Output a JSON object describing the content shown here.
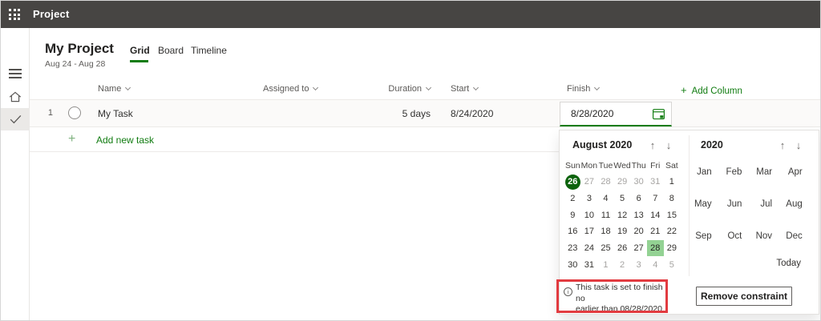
{
  "topbar": {
    "title": "Project"
  },
  "header": {
    "title": "My Project",
    "date_range": "Aug 24 - Aug 28",
    "tabs": [
      {
        "label": "Grid",
        "active": true
      },
      {
        "label": "Board",
        "active": false
      },
      {
        "label": "Timeline",
        "active": false
      }
    ]
  },
  "grid": {
    "columns": [
      {
        "label": "Name"
      },
      {
        "label": "Assigned to"
      },
      {
        "label": "Duration"
      },
      {
        "label": "Start"
      },
      {
        "label": "Finish"
      }
    ],
    "add_column_label": "Add Column",
    "row": {
      "index": "1",
      "name": "My Task",
      "assigned_to": "",
      "duration": "5 days",
      "start": "8/24/2020"
    },
    "add_new_task_label": "Add new task"
  },
  "finish_editor": {
    "value": "8/28/2020"
  },
  "calendar": {
    "title": "August 2020",
    "day_headers": [
      "Sun",
      "Mon",
      "Tue",
      "Wed",
      "Thu",
      "Fri",
      "Sat"
    ],
    "days": [
      {
        "t": "26",
        "s": "today"
      },
      {
        "t": "27",
        "s": "muted"
      },
      {
        "t": "28",
        "s": "muted"
      },
      {
        "t": "29",
        "s": "muted"
      },
      {
        "t": "30",
        "s": "muted"
      },
      {
        "t": "31",
        "s": "muted"
      },
      {
        "t": "1"
      },
      {
        "t": "2"
      },
      {
        "t": "3"
      },
      {
        "t": "4"
      },
      {
        "t": "5"
      },
      {
        "t": "6"
      },
      {
        "t": "7"
      },
      {
        "t": "8"
      },
      {
        "t": "9"
      },
      {
        "t": "10"
      },
      {
        "t": "11"
      },
      {
        "t": "12"
      },
      {
        "t": "13"
      },
      {
        "t": "14"
      },
      {
        "t": "15"
      },
      {
        "t": "16"
      },
      {
        "t": "17"
      },
      {
        "t": "18"
      },
      {
        "t": "19"
      },
      {
        "t": "20"
      },
      {
        "t": "21"
      },
      {
        "t": "22"
      },
      {
        "t": "23"
      },
      {
        "t": "24"
      },
      {
        "t": "25"
      },
      {
        "t": "26"
      },
      {
        "t": "27"
      },
      {
        "t": "28",
        "s": "selected"
      },
      {
        "t": "29"
      },
      {
        "t": "30"
      },
      {
        "t": "31"
      },
      {
        "t": "1",
        "s": "muted"
      },
      {
        "t": "2",
        "s": "muted"
      },
      {
        "t": "3",
        "s": "muted"
      },
      {
        "t": "4",
        "s": "muted"
      },
      {
        "t": "5",
        "s": "muted"
      }
    ]
  },
  "year_panel": {
    "title": "2020",
    "months": [
      "Jan",
      "Feb",
      "Mar",
      "Apr",
      "May",
      "Jun",
      "Jul",
      "Aug",
      "Sep",
      "Oct",
      "Nov",
      "Dec"
    ],
    "today_label": "Today"
  },
  "constraint": {
    "message_line1": "This task is set to finish no",
    "message_line2": "earlier than 08/28/2020",
    "remove_button_label": "Remove constraint"
  },
  "icons": {
    "plus": "+",
    "up_arrow": "↑",
    "down_arrow": "↓",
    "info": "i"
  },
  "colors": {
    "accent_green": "#107c10",
    "today_green": "#0d630d",
    "selected_green": "#93d293",
    "annotation_red": "#e23b40",
    "topbar_bg": "#474543"
  }
}
